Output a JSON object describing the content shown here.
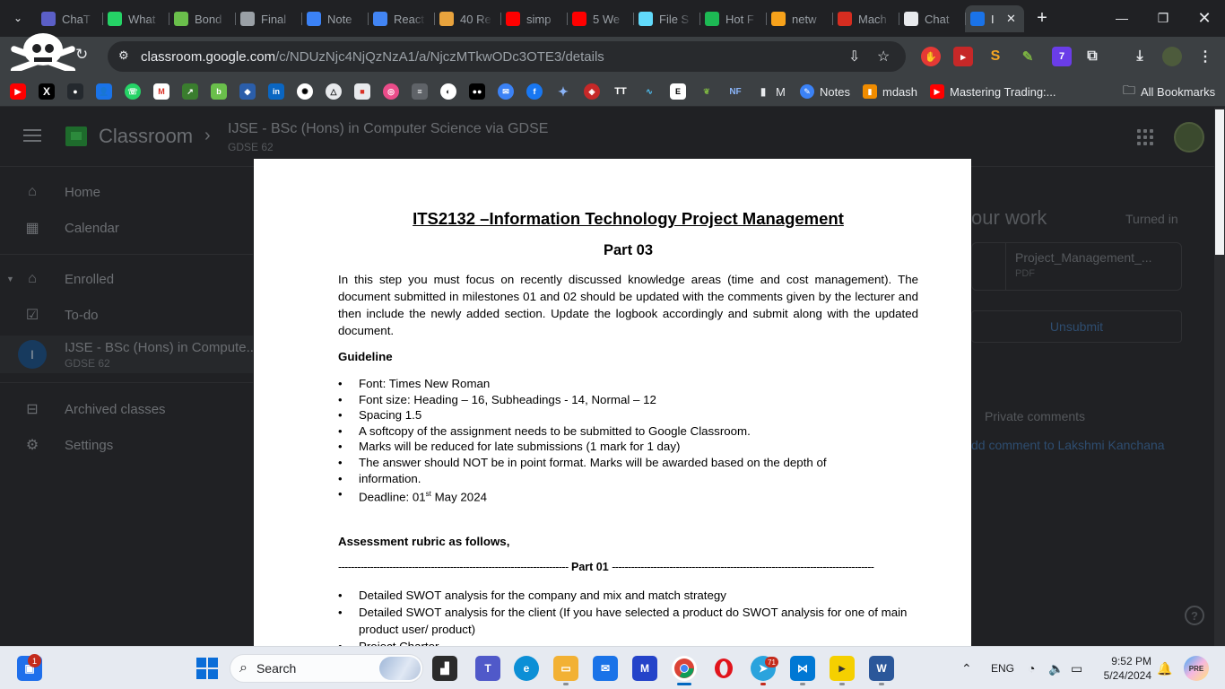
{
  "browser": {
    "tabs": [
      {
        "title": "ChaT",
        "icon": "chat-app-icon",
        "color": "#5b5fc7"
      },
      {
        "title": "What",
        "icon": "whatsapp-icon",
        "color": "#25d366"
      },
      {
        "title": "Bond",
        "icon": "bond-icon",
        "color": "#6abf4b"
      },
      {
        "title": "Final",
        "icon": "globe-icon",
        "color": "#9aa0a6"
      },
      {
        "title": "Note",
        "icon": "notes-icon",
        "color": "#3b82f6"
      },
      {
        "title": "React",
        "icon": "docs-icon",
        "color": "#4285f4"
      },
      {
        "title": "40 Re",
        "icon": "chart-icon",
        "color": "#e8a33d"
      },
      {
        "title": "simp",
        "icon": "youtube-icon",
        "color": "#ff0000"
      },
      {
        "title": "5 We",
        "icon": "youtube-icon",
        "color": "#ff0000"
      },
      {
        "title": "File S",
        "icon": "react-icon",
        "color": "#61dafb"
      },
      {
        "title": "Hot F",
        "icon": "spotify-icon",
        "color": "#1db954"
      },
      {
        "title": "netw",
        "icon": "network-icon",
        "color": "#f7a21b"
      },
      {
        "title": "Mach",
        "icon": "v-icon",
        "color": "#d62d20"
      },
      {
        "title": "Chat",
        "icon": "chatgpt-icon",
        "color": "#e8eaed"
      },
      {
        "title": "I",
        "icon": "classroom-icon",
        "color": "#1a73e8",
        "active": true
      }
    ],
    "url_host": "classroom.google.com",
    "url_path": "/c/NDUzNjc4NjQzNzA1/a/NjczMTkwODc3OTE3/details",
    "bookmarks_text": [
      {
        "label": "Notes",
        "icon": "notes-icon",
        "color": "#3b82f6"
      },
      {
        "label": "mdash",
        "icon": "mdash-icon",
        "color": "#f08c00"
      },
      {
        "label": "Mastering Trading:...",
        "icon": "youtube-icon",
        "color": "#ff0000"
      }
    ],
    "bookmark_m_label": "M",
    "all_bookmarks": "All Bookmarks"
  },
  "classroom": {
    "app_name": "Classroom",
    "course_title": "IJSE - BSc (Hons) in Computer Science via GDSE",
    "course_section": "GDSE 62",
    "nav": {
      "home": "Home",
      "calendar": "Calendar",
      "enrolled": "Enrolled",
      "todo": "To-do",
      "course_item": "IJSE - BSc (Hons) in Compute...",
      "course_item_sub": "GDSE 62",
      "course_letter": "I",
      "archived": "Archived classes",
      "settings": "Settings"
    },
    "your_work": {
      "title": "our work",
      "status": "Turned in",
      "file_name": "Project_Management_...",
      "file_type": "PDF",
      "unsubmit": "Unsubmit"
    },
    "private_comments": {
      "title": "Private comments",
      "add": "dd comment to Lakshmi Kanchana"
    }
  },
  "document": {
    "title": "ITS2132 –Information Technology Project Management",
    "part": "Part 03",
    "intro": "In this step you must focus on recently discussed knowledge areas (time and cost management). The document submitted in milestones 01 and 02 should be updated with the comments given by the lecturer and then include the newly added section. Update the logbook accordingly and submit along with the updated document.",
    "guideline_heading": "Guideline",
    "guidelines": [
      "Font: Times New Roman",
      "Font size: Heading – 16, Subheadings - 14, Normal – 12",
      "Spacing 1.5",
      "A softcopy of the assignment needs to be submitted to Google Classroom.",
      "Marks will be reduced for late submissions (1 mark for 1 day)",
      "The answer should NOT be in point format. Marks will be awarded based on the depth of",
      "information."
    ],
    "deadline_prefix": "Deadline: 01",
    "deadline_sup": "st",
    "deadline_suffix": " May 2024",
    "rubric_heading": "Assessment rubric as follows,",
    "part01_label": "Part 01",
    "rubric_items": [
      "Detailed SWOT analysis for the company and mix and match strategy",
      "Detailed SWOT analysis for the client (If you have selected a product do SWOT analysis for one of main product user/ product)",
      "Project Charter"
    ]
  },
  "taskbar": {
    "search_placeholder": "Search",
    "language": "ENG",
    "time": "9:52 PM",
    "date": "5/24/2024",
    "widgets_badge": "1",
    "telegram_badge": "71"
  }
}
